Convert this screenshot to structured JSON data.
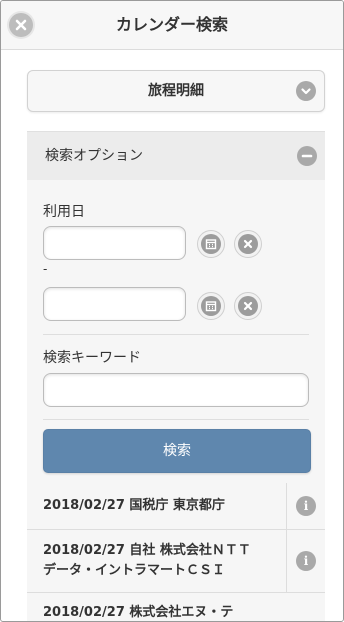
{
  "header": {
    "title": "カレンダー検索"
  },
  "category_select": {
    "selected": "旅程明細"
  },
  "search_options": {
    "title": "検索オプション",
    "date_label": "利用日",
    "range_separator": "-",
    "date_from": {
      "value": "",
      "placeholder": ""
    },
    "date_to": {
      "value": "",
      "placeholder": ""
    },
    "keyword_label": "検索キーワード",
    "keyword": {
      "value": "",
      "placeholder": ""
    },
    "search_button": "検索"
  },
  "results": [
    {
      "text": "2018/02/27 国税庁 東京都庁"
    },
    {
      "text": "2018/02/27 自社 株式会社ＮＴＴ\nデータ・イントラマートＣＳＩ"
    },
    {
      "text": "2018/02/27 株式会社エヌ・テ"
    }
  ],
  "colors": {
    "primary_button": "#5f87ae",
    "icon_grey": "#a9a9a9",
    "panel_bg": "#f6f6f6"
  },
  "icons": [
    "close-icon",
    "chevron-down-icon",
    "minus-icon",
    "calendar-icon",
    "clear-icon",
    "info-icon"
  ]
}
